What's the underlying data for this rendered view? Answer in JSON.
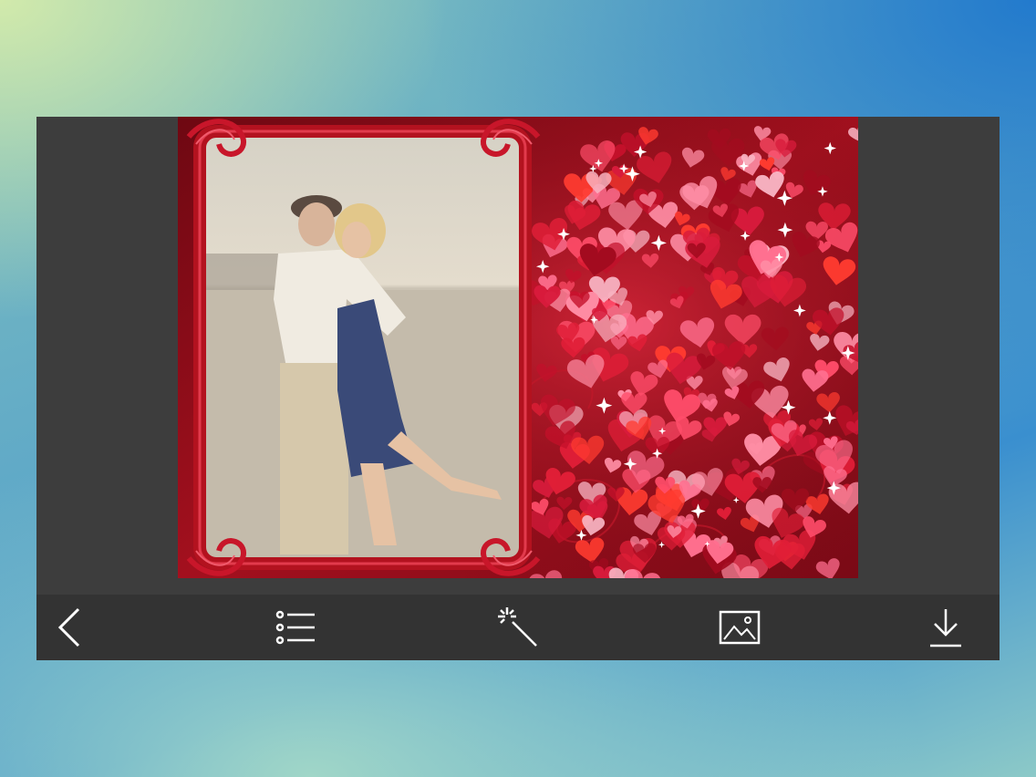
{
  "colors": {
    "toolbar_bg": "#333333",
    "window_bg": "#3d3d3d",
    "icon_color": "#ffffff",
    "frame_red": "#b3121f",
    "heart_pink": "#ff6f8f"
  },
  "editor": {
    "frame_style": "red-hearts-ornate-frame",
    "photo_subject": "couple-embracing-on-beach"
  },
  "toolbar": {
    "items": [
      {
        "icon": "chevron-left-icon",
        "action": "back"
      },
      {
        "icon": "list-icon",
        "action": "frames"
      },
      {
        "icon": "magic-wand-icon",
        "action": "effects"
      },
      {
        "icon": "image-icon",
        "action": "gallery"
      },
      {
        "icon": "download-icon",
        "action": "save"
      }
    ]
  }
}
